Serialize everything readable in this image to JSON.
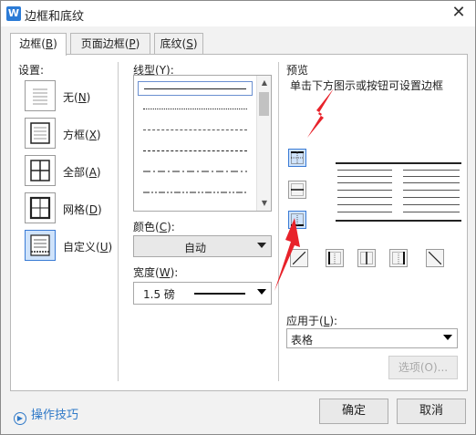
{
  "window": {
    "title": "边框和底纹",
    "app_icon": "W",
    "close_glyph": "✕"
  },
  "tabs": [
    {
      "label": "边框(",
      "key": "B",
      "suffix": ")"
    },
    {
      "label": "页面边框(",
      "key": "P",
      "suffix": ")"
    },
    {
      "label": "底纹(",
      "key": "S",
      "suffix": ")"
    }
  ],
  "settings": {
    "heading": "设置:",
    "items": [
      {
        "label": "无(",
        "key": "N",
        "suffix": ")"
      },
      {
        "label": "方框(",
        "key": "X",
        "suffix": ")"
      },
      {
        "label": "全部(",
        "key": "A",
        "suffix": ")"
      },
      {
        "label": "网格(",
        "key": "D",
        "suffix": ")"
      },
      {
        "label": "自定义(",
        "key": "U",
        "suffix": ")"
      }
    ],
    "selected_index": 4
  },
  "line_style": {
    "heading": "线型(",
    "key": "Y",
    "suffix": "):"
  },
  "color": {
    "heading": "颜色(",
    "key": "C",
    "suffix": "):",
    "value": "自动"
  },
  "width": {
    "heading": "宽度(",
    "key": "W",
    "suffix": "):",
    "value": "1.5 磅"
  },
  "preview": {
    "heading": "预览",
    "hint": "单击下方图示或按钮可设置边框"
  },
  "apply_to": {
    "heading": "应用于(",
    "key": "L",
    "suffix": "):",
    "value": "表格"
  },
  "buttons": {
    "options": "选项(O)...",
    "ok": "确定",
    "cancel": "取消"
  },
  "tips": {
    "label": "操作技巧",
    "icon": "play-circle-icon"
  },
  "colors": {
    "accent": "#3a7bd5",
    "annotation_red": "#e8222a",
    "link": "#2f79c8"
  }
}
